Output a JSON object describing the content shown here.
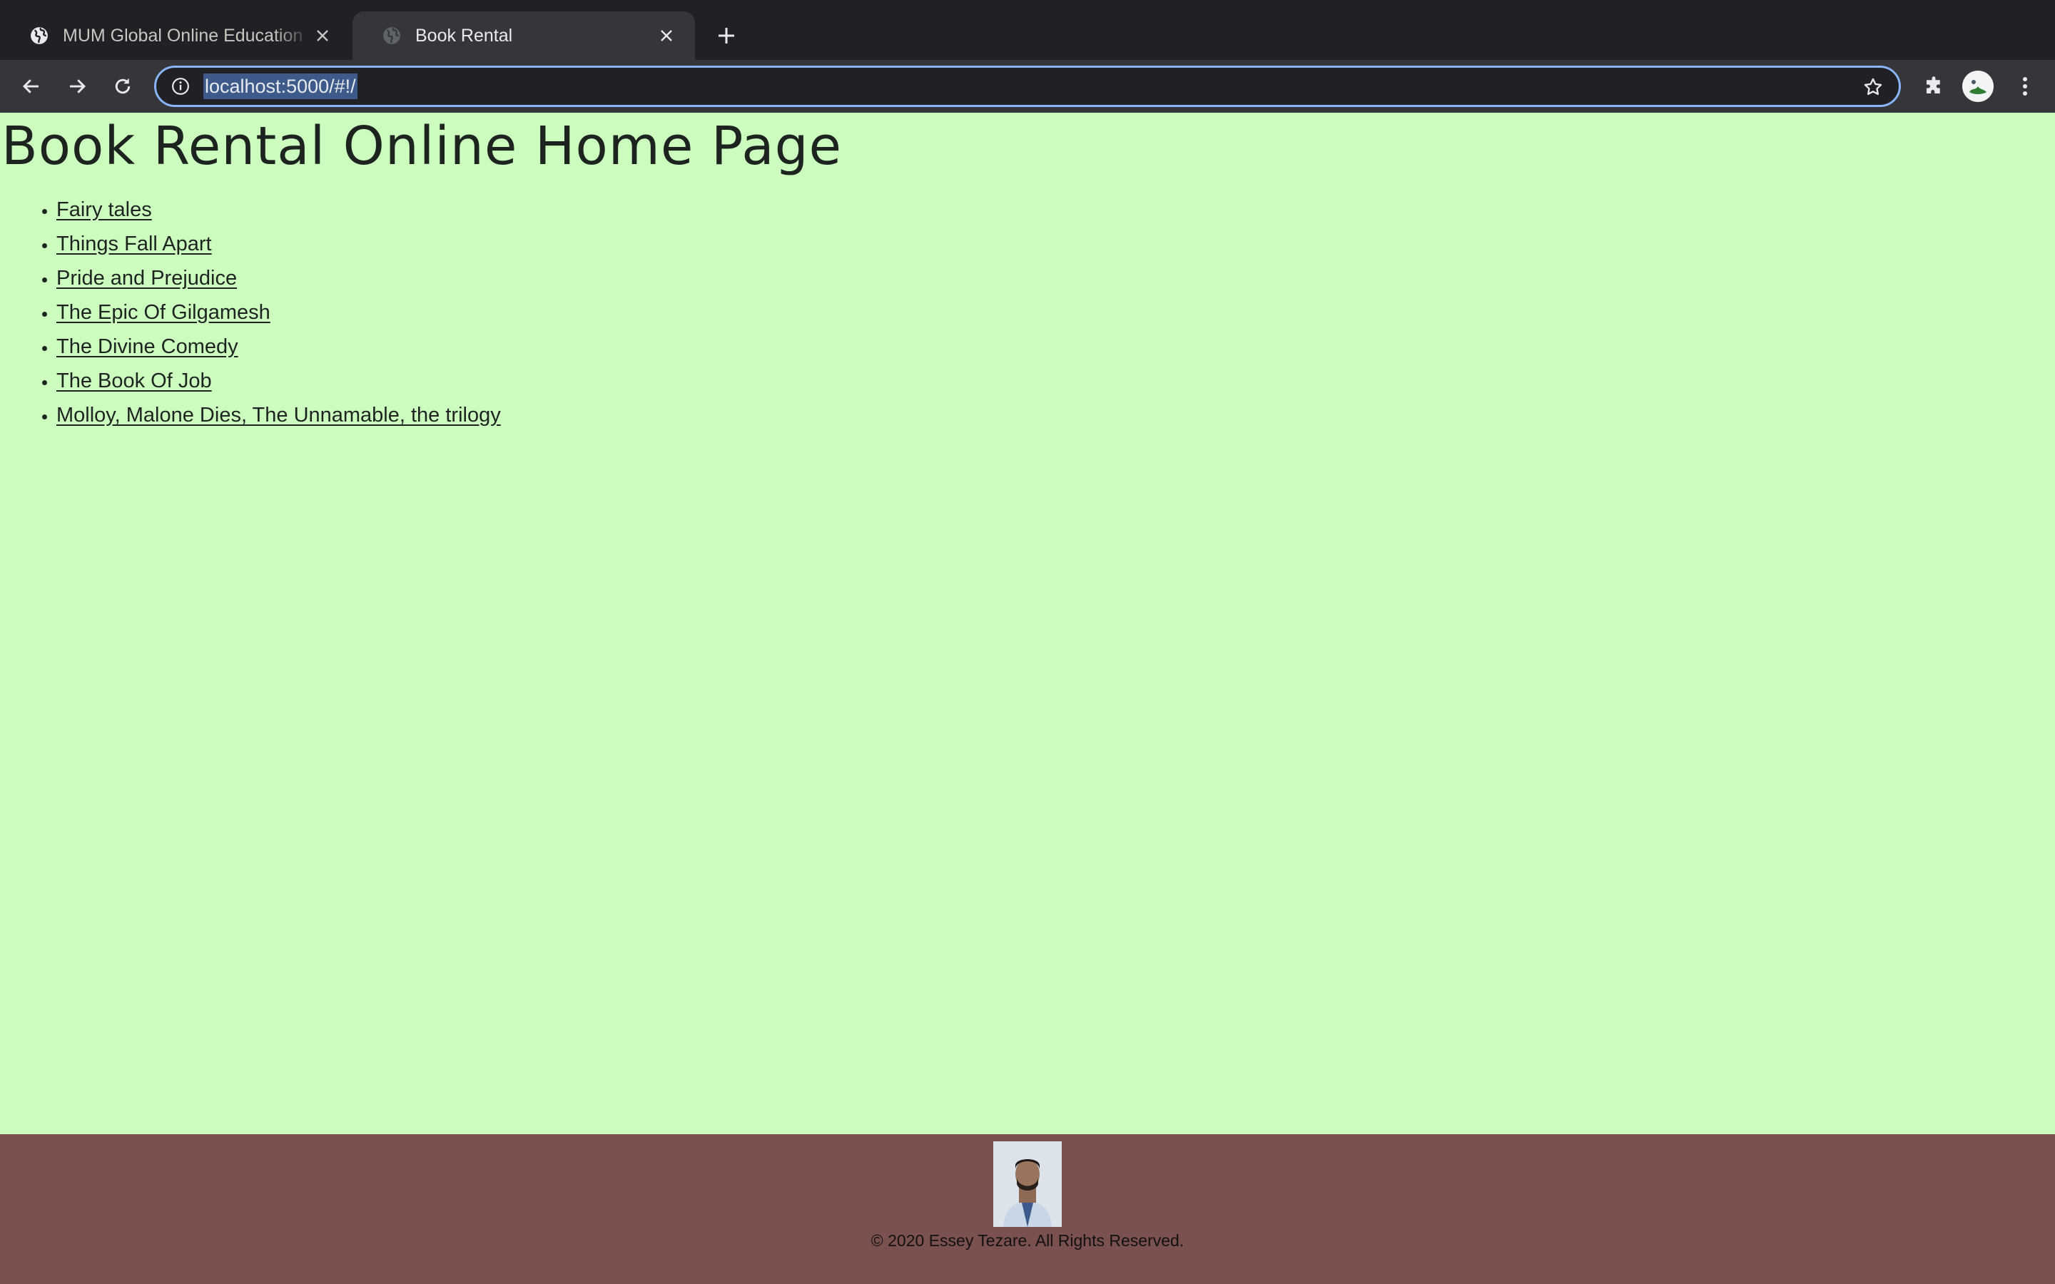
{
  "browser": {
    "tabs": [
      {
        "title": "MUM Global Online Education",
        "favicon": "globe-icon",
        "active": false
      },
      {
        "title": "Book Rental",
        "favicon": "globe-icon",
        "active": true
      }
    ],
    "url": "localhost:5000/#!/"
  },
  "page": {
    "heading": "Book Rental Online Home Page",
    "books": [
      "Fairy tales",
      "Things Fall Apart",
      "Pride and Prejudice",
      "The Epic Of Gilgamesh",
      "The Divine Comedy",
      "The Book Of Job",
      "Molloy, Malone Dies, The Unnamable, the trilogy"
    ]
  },
  "footer": {
    "copyright": "© 2020 Essey Tezare. All Rights Reserved."
  },
  "colors": {
    "page_background": "#ccfdbf",
    "footer_background": "#7b5150",
    "chrome_dark": "#202124",
    "chrome_toolbar": "#35363a"
  }
}
